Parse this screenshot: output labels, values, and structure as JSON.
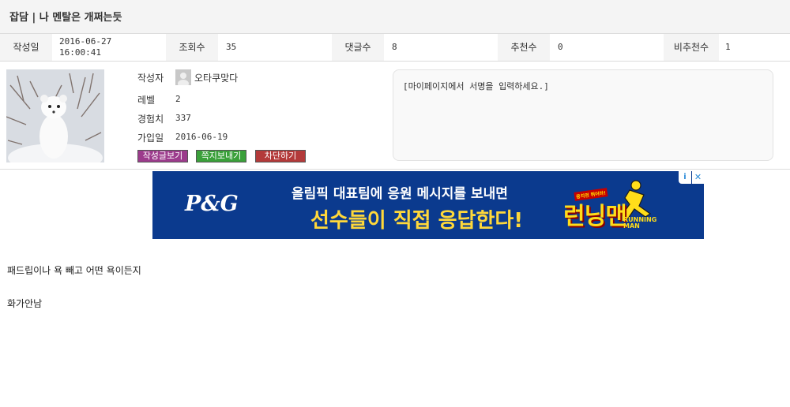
{
  "post": {
    "title": "잡담 | 나 멘탈은 개쩌는듯",
    "body": [
      "패드립이나 욕 빼고 어떤 욕이든지",
      "화가안남"
    ]
  },
  "meta": {
    "date_label": "작성일",
    "date_line1": "2016-06-27",
    "date_line2": "16:00:41",
    "views_label": "조회수",
    "views_value": "35",
    "comments_label": "댓글수",
    "comments_value": "8",
    "likes_label": "추천수",
    "likes_value": "0",
    "dislikes_label": "비추천수",
    "dislikes_value": "1"
  },
  "author": {
    "author_label": "작성자",
    "name": "오타쿠맞다",
    "level_label": "레벨",
    "level_value": "2",
    "exp_label": "경험치",
    "exp_value": "337",
    "joined_label": "가입일",
    "joined_value": "2016-06-19",
    "buttons": [
      {
        "label": "작성글보기",
        "color": "#9c3b8c"
      },
      {
        "label": "쪽지보내기",
        "color": "#3aa03a"
      },
      {
        "label": "차단하기",
        "color": "#b33a3a"
      }
    ],
    "signature": "[마이페이지에서 서명을 입력하세요.]"
  },
  "ad": {
    "brand": "P&G",
    "line1": "올림픽 대표팀에 응원 메시지를 보내면",
    "line2": "선수들이 직접 응답한다!",
    "logo_sub": "뭉치면 뛰어라!",
    "logo_text": "런닝맨",
    "logo_eng_line1": "RUNNING",
    "logo_eng_line2": "MAN",
    "info_glyph": "i",
    "close_glyph": "✕"
  },
  "icons": {
    "avatar": "ermine-photo-icon",
    "mini_avatar": "user-thumbnail-icon",
    "ad_info": "info-icon",
    "ad_close": "close-icon"
  }
}
